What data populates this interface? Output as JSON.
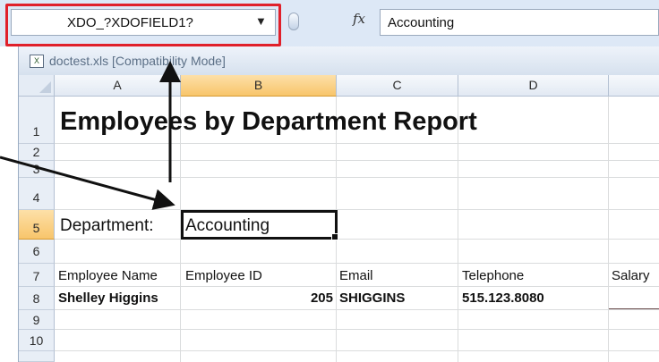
{
  "formula_bar": {
    "name_box": "XDO_?XDOFIELD1?",
    "fx_label": "fx",
    "formula_value": "Accounting"
  },
  "workbook": {
    "title": "doctest.xls  [Compatibility Mode]"
  },
  "columns": [
    "A",
    "B",
    "C",
    "D"
  ],
  "rows": [
    "1",
    "2",
    "3",
    "4",
    "5",
    "6",
    "7",
    "8",
    "9",
    "10"
  ],
  "sheet": {
    "report_title": "Employees by Department Report",
    "department_label": "Department:",
    "department_value": "Accounting",
    "headers": {
      "employee_name": "Employee Name",
      "employee_id": "Employee ID",
      "email": "Email",
      "telephone": "Telephone",
      "salary": "Salary"
    },
    "row8": {
      "employee_name": "Shelley Higgins",
      "employee_id": "205",
      "email": "SHIGGINS",
      "telephone": "515.123.8080"
    }
  },
  "colors": {
    "highlight_box": "#e0202a",
    "active_header": "#f8c56b"
  }
}
